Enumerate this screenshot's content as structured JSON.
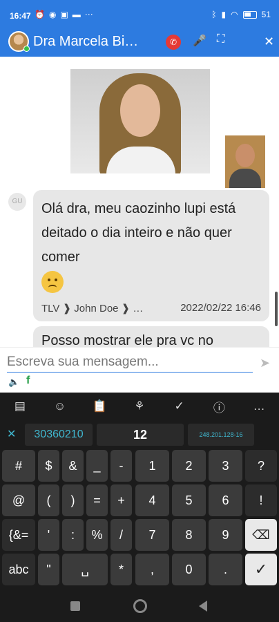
{
  "status_bar": {
    "time": "16:47",
    "left_icons": [
      "alarm-icon",
      "whatsapp-icon",
      "tv-icon",
      "cast-icon",
      "more-icon"
    ],
    "right_icons": [
      "bluetooth-icon",
      "signal-icon",
      "wifi-icon",
      "battery-icon"
    ],
    "battery": "51"
  },
  "call_header": {
    "title": "Dra Marcela Bi…",
    "icons": [
      "hangup-icon",
      "mic-icon",
      "expand-icon",
      "close-icon"
    ]
  },
  "chat": {
    "sender_initials": "GU",
    "messages": [
      {
        "text": "Olá dra, meu caozinho lupi está deitado o dia inteiro e não quer comer",
        "emoji": "slightly-frowning-face",
        "meta_left": "TLV ❱ John Doe ❱ …",
        "timestamp": "2022/02/22 16:46"
      },
      {
        "text": "Posso mostrar ele pra vc no"
      }
    ]
  },
  "composer": {
    "placeholder": "Escreva sua mensagem...",
    "value": "",
    "send_icon": "send-icon",
    "extra_icons": [
      "speaker-icon",
      "facebook-icon"
    ]
  },
  "keyboard": {
    "toolbar": [
      "gif",
      "sticker",
      "clipboard",
      "translate",
      "check",
      "info",
      "…"
    ],
    "suggestions": {
      "left": "30360210",
      "center": "12",
      "right": "248.201.128-16"
    },
    "rows": [
      [
        "#",
        "$",
        "&",
        "_",
        "-",
        "1",
        "2",
        "3",
        "?"
      ],
      [
        "@",
        "(",
        ")",
        "=",
        "+",
        "4",
        "5",
        "6",
        "!"
      ],
      [
        "{&=",
        "'",
        ":",
        "%",
        "/",
        "7",
        "8",
        "9",
        "⌫"
      ],
      [
        "abc",
        "\"",
        "␣",
        "*",
        ",",
        "0",
        ".",
        "✓"
      ]
    ]
  },
  "nav_bar": {
    "icons": [
      "recents-icon",
      "home-icon",
      "back-icon"
    ]
  }
}
